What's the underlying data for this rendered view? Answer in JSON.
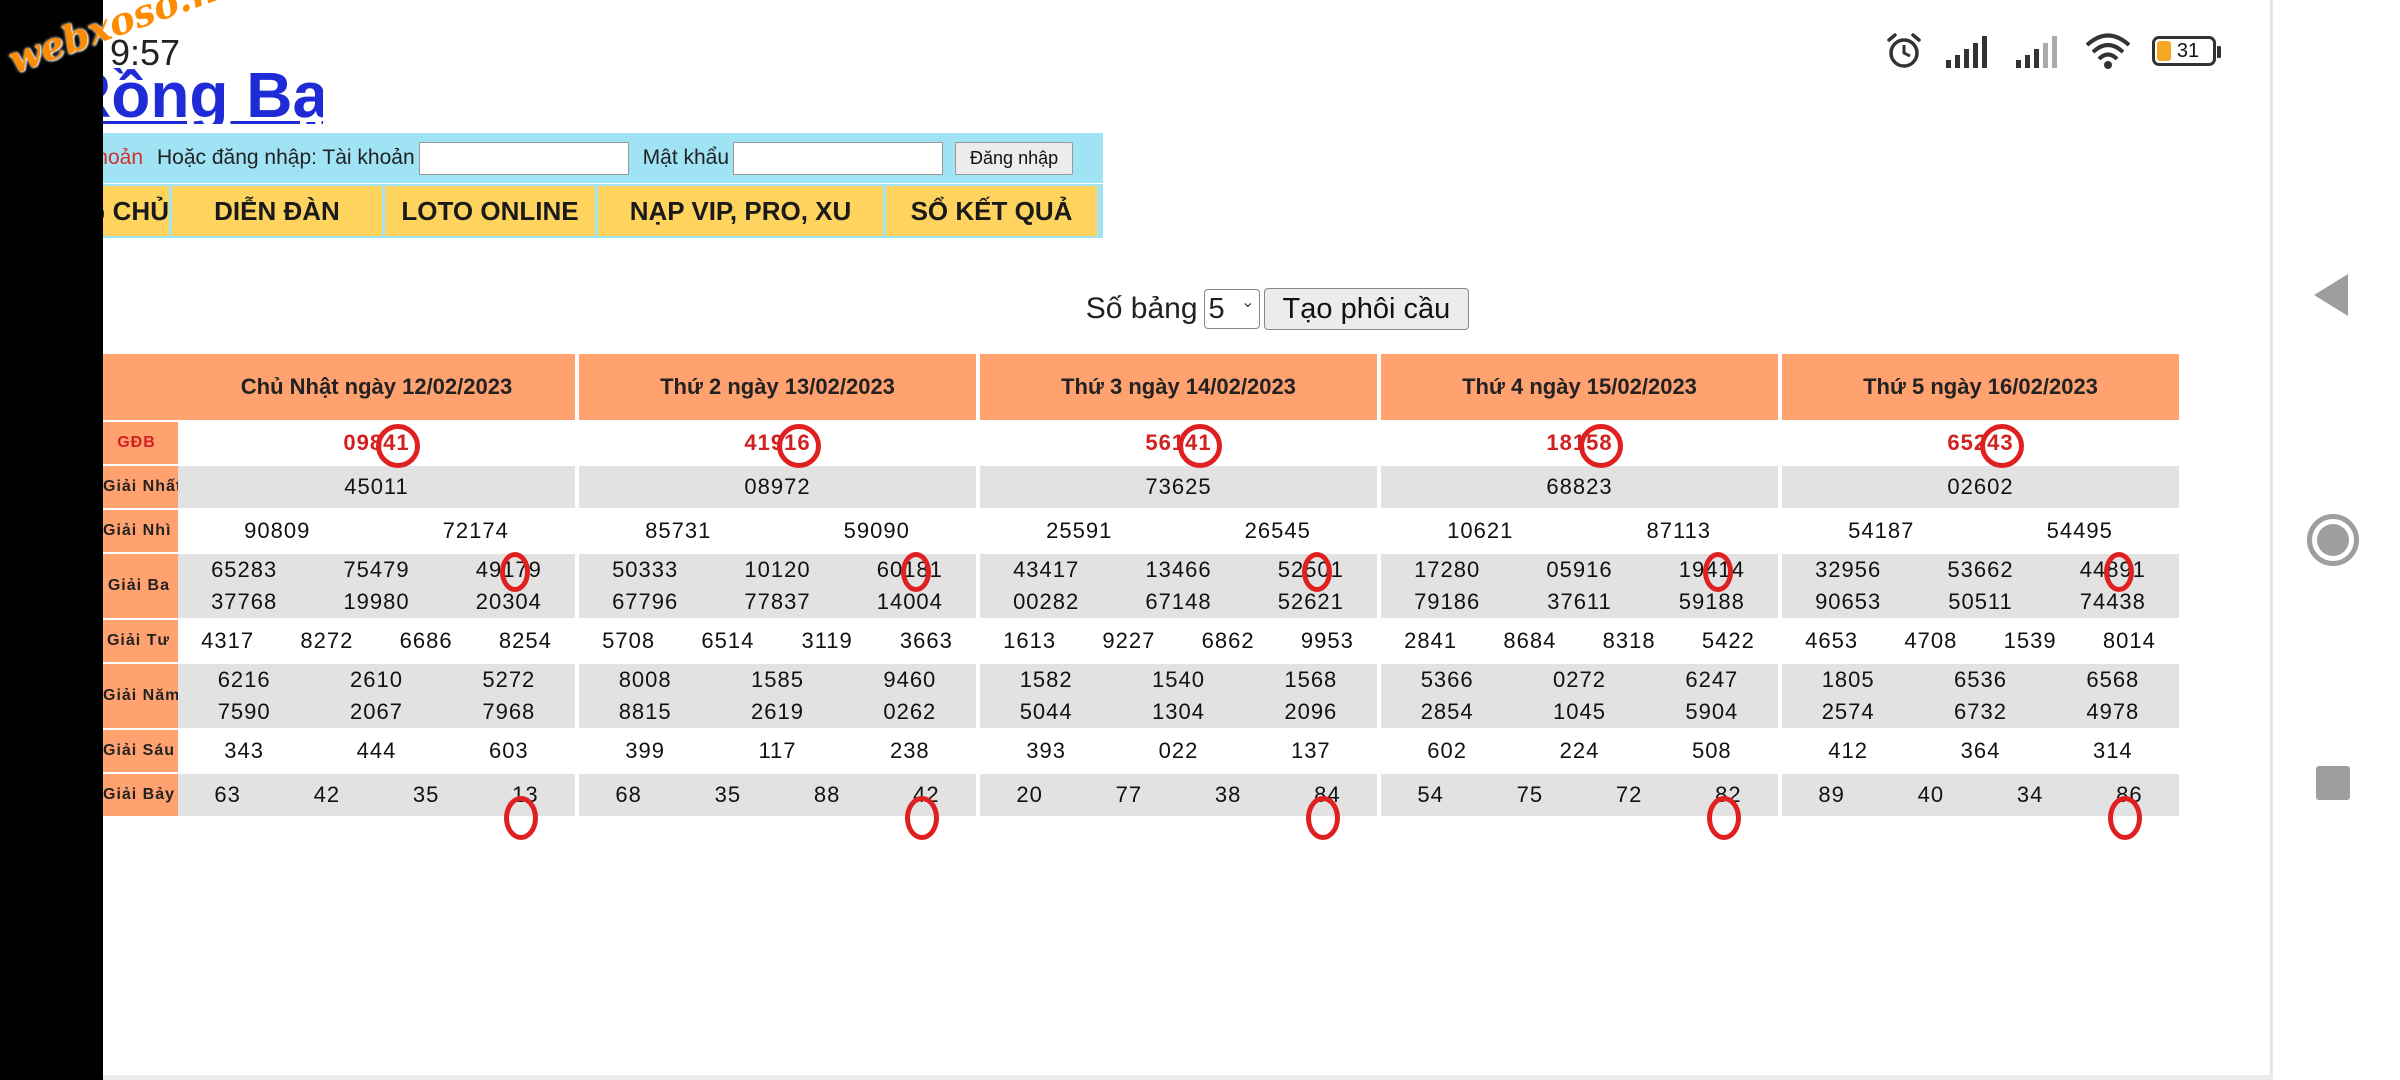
{
  "status": {
    "time": "9:57",
    "battery": "31"
  },
  "watermark": "webxoso.net",
  "site": {
    "logo_text": "Rồng Bạch Kim",
    "login": {
      "register_label": "Đăng ký tài khoản",
      "or_login_label": "Hoặc đăng nhập: Tài khoản",
      "password_label": "Mật khẩu",
      "login_button": "Đăng nhập"
    },
    "menu": [
      "TRANG CHỦ",
      "DIỄN ĐÀN",
      "LOTO ONLINE",
      "NẠP VIP, PRO, XU",
      "SỔ KẾT QUẢ"
    ]
  },
  "controls": {
    "label": "Số bảng",
    "selected": "5",
    "button": "Tạo phôi cầu"
  },
  "row_labels": [
    "GĐB",
    "Giải Nhất",
    "Giải Nhì",
    "Giải Ba",
    "Giải Tư",
    "Giải Năm",
    "Giải Sáu",
    "Giải Bảy"
  ],
  "days": [
    {
      "title": "Chủ Nhật ngày 12/02/2023",
      "db": "09841",
      "g1": "45011",
      "g2": [
        "90809",
        "72174"
      ],
      "g3": [
        "65283",
        "75479",
        "49179",
        "37768",
        "19980",
        "20304"
      ],
      "g4": [
        "4317",
        "8272",
        "6686",
        "8254"
      ],
      "g5": [
        "6216",
        "2610",
        "5272",
        "7590",
        "2067",
        "7968"
      ],
      "g6": [
        "343",
        "444",
        "603"
      ],
      "g7": [
        "63",
        "42",
        "35",
        "13"
      ]
    },
    {
      "title": "Thứ 2 ngày 13/02/2023",
      "db": "41916",
      "g1": "08972",
      "g2": [
        "85731",
        "59090"
      ],
      "g3": [
        "50333",
        "10120",
        "60181",
        "67796",
        "77837",
        "14004"
      ],
      "g4": [
        "5708",
        "6514",
        "3119",
        "3663"
      ],
      "g5": [
        "8008",
        "1585",
        "9460",
        "8815",
        "2619",
        "0262"
      ],
      "g6": [
        "399",
        "117",
        "238"
      ],
      "g7": [
        "68",
        "35",
        "88",
        "42"
      ]
    },
    {
      "title": "Thứ 3 ngày 14/02/2023",
      "db": "56141",
      "g1": "73625",
      "g2": [
        "25591",
        "26545"
      ],
      "g3": [
        "43417",
        "13466",
        "52501",
        "00282",
        "67148",
        "52621"
      ],
      "g4": [
        "1613",
        "9227",
        "6862",
        "9953"
      ],
      "g5": [
        "1582",
        "1540",
        "1568",
        "5044",
        "1304",
        "2096"
      ],
      "g6": [
        "393",
        "022",
        "137"
      ],
      "g7": [
        "20",
        "77",
        "38",
        "84"
      ]
    },
    {
      "title": "Thứ 4 ngày 15/02/2023",
      "db": "18158",
      "g1": "68823",
      "g2": [
        "10621",
        "87113"
      ],
      "g3": [
        "17280",
        "05916",
        "19414",
        "79186",
        "37611",
        "59188"
      ],
      "g4": [
        "2841",
        "8684",
        "8318",
        "5422"
      ],
      "g5": [
        "5366",
        "0272",
        "6247",
        "2854",
        "1045",
        "5904"
      ],
      "g6": [
        "602",
        "224",
        "508"
      ],
      "g7": [
        "54",
        "75",
        "72",
        "82"
      ]
    },
    {
      "title": "Thứ 5 ngày 16/02/2023",
      "db": "65243",
      "g1": "02602",
      "g2": [
        "54187",
        "54495"
      ],
      "g3": [
        "32956",
        "53662",
        "44891",
        "90653",
        "50511",
        "74438"
      ],
      "g4": [
        "4653",
        "4708",
        "1539",
        "8014"
      ],
      "g5": [
        "1805",
        "6536",
        "6568",
        "2574",
        "6732",
        "4978"
      ],
      "g6": [
        "412",
        "364",
        "314"
      ],
      "g7": [
        "89",
        "40",
        "34",
        "86"
      ]
    }
  ]
}
